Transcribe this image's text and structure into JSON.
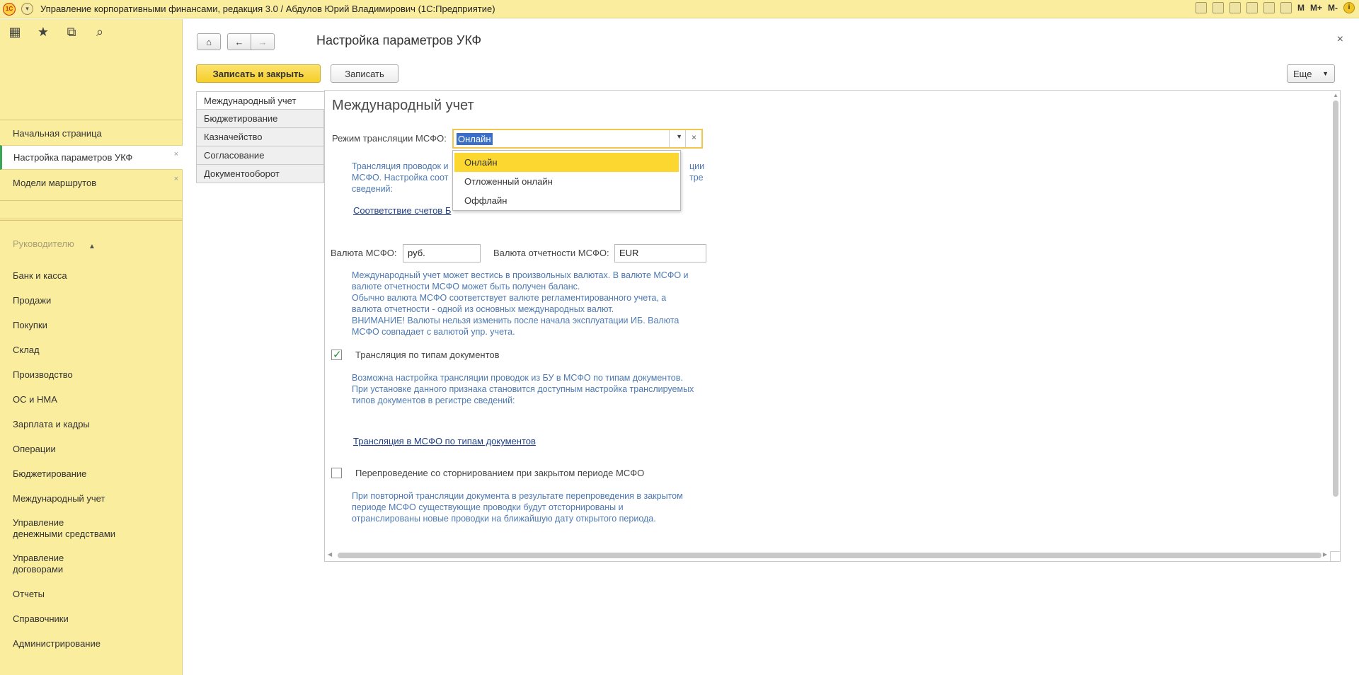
{
  "titlebar": {
    "title": "Управление корпоративными финансами, редакция 3.0 / Абдулов Юрий Владимирович (1С:Предприятие)",
    "logo_text": "1С",
    "m_buttons": [
      "M",
      "M+",
      "M-"
    ]
  },
  "sidebar": {
    "nav": [
      {
        "label": "Начальная страница"
      },
      {
        "label": "Настройка параметров УКФ"
      },
      {
        "label": "Модели маршрутов"
      }
    ],
    "sections": [
      "Руководителю",
      "Банк и касса",
      "Продажи",
      "Покупки",
      "Склад",
      "Производство",
      "ОС и НМА",
      "Зарплата и кадры",
      "Операции",
      "Бюджетирование",
      "Международный учет",
      [
        "Управление",
        "денежными средствами"
      ],
      [
        "Управление",
        "договорами"
      ],
      "Отчеты",
      "Справочники",
      "Администрирование"
    ]
  },
  "page": {
    "title": "Настройка параметров УКФ",
    "save_close_label": "Записать и закрыть",
    "save_label": "Записать",
    "more_label": "Еще"
  },
  "tabs": [
    "Международный учет",
    "Бюджетирование",
    "Казначейство",
    "Согласование",
    "Документооборот"
  ],
  "form": {
    "section_title": "Международный учет",
    "mode_label": "Режим трансляции МСФО:",
    "mode_value": "Онлайн",
    "mode_options": [
      "Онлайн",
      "Отложенный онлайн",
      "Оффлайн"
    ],
    "mode_hint_left": [
      "Трансляция проводок и",
      "МСФО. Настройка соот",
      "сведений:"
    ],
    "mode_hint_right": [
      "ции",
      "тре"
    ],
    "accounts_link": "Соответствие счетов Б",
    "currency_label": "Валюта МСФО:",
    "currency_value": "руб.",
    "report_currency_label": "Валюта отчетности МСФО:",
    "report_currency_value": "EUR",
    "currency_hint": [
      "Международный учет может вестись в произвольных валютах. В валюте МСФО и",
      "валюте отчетности МСФО может быть получен баланс.",
      "Обычно валюта МСФО соответствует валюте регламентированного учета, а",
      "валюта отчетности - одной из основных международных валют.",
      "ВНИМАНИЕ! Валюты нельзя изменить после начала эксплуатации ИБ. Валюта",
      "МСФО совпадает с валютой упр. учета."
    ],
    "doc_types_checkbox": "Трансляция по типам документов",
    "doc_types_checked": true,
    "doc_types_hint": [
      "Возможна настройка трансляции проводок из БУ в МСФО по типам документов.",
      "При установке данного признака становится доступным настройка транслируемых",
      "типов документов в регистре сведений:"
    ],
    "doc_types_link": "Трансляция в МСФО по типам документов",
    "repost_checkbox": "Перепроведение со сторнированием при закрытом периоде МСФО",
    "repost_checked": false,
    "repost_hint": [
      "При повторной трансляции документа в результате перепроведения в закрытом",
      "периоде МСФО существующие проводки будут отсторнированы и",
      "отранслированы новые проводки на ближайшую дату открытого периода."
    ]
  }
}
